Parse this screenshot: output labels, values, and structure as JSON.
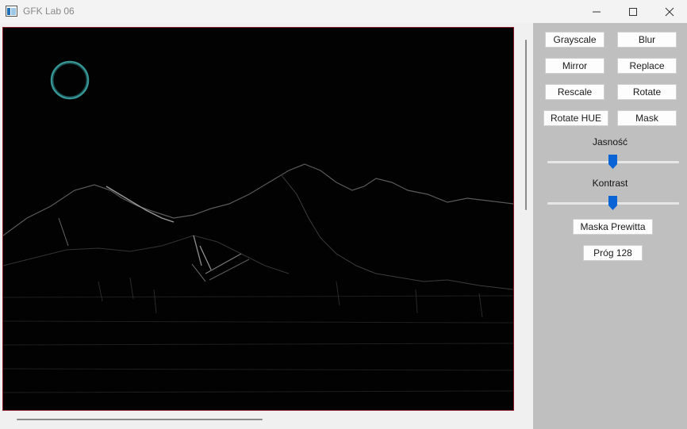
{
  "window": {
    "title": "GFK Lab 06"
  },
  "controls": {
    "buttons": [
      {
        "label": "Grayscale"
      },
      {
        "label": "Blur"
      },
      {
        "label": "Mirror"
      },
      {
        "label": "Replace"
      },
      {
        "label": "Rescale"
      },
      {
        "label": "Rotate"
      },
      {
        "label": "Rotate HUE"
      },
      {
        "label": "Mask"
      }
    ],
    "brightness": {
      "label": "Jasność",
      "value": 0.5
    },
    "contrast": {
      "label": "Kontrast",
      "value": 0.5
    },
    "prewitt_button": "Maska Prewitta",
    "threshold_button": "Próg 128"
  },
  "colors": {
    "accent": "#0a64d6",
    "canvas_border": "#8b1e2a",
    "panel_bg": "#bfbfbf"
  }
}
